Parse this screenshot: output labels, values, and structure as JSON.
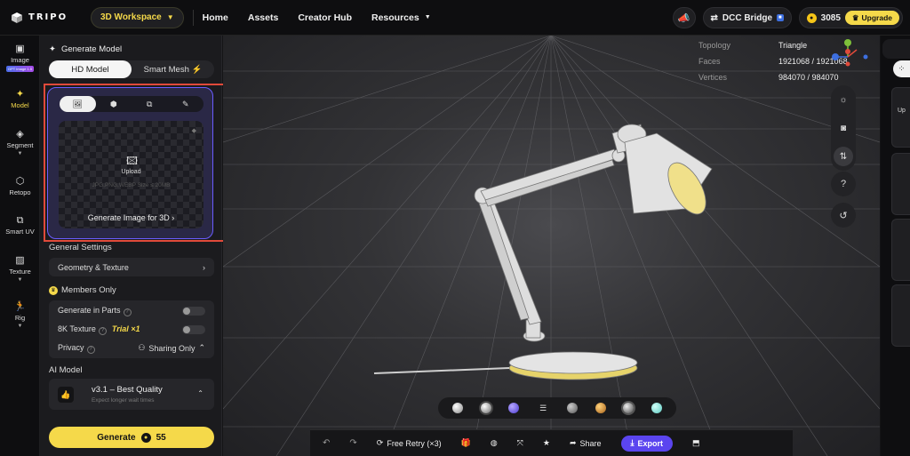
{
  "topbar": {
    "logo_text": "TRIPO",
    "workspace_label": "3D Workspace",
    "nav": [
      {
        "label": "Home"
      },
      {
        "label": "Assets"
      },
      {
        "label": "Creator Hub"
      },
      {
        "label": "Resources"
      }
    ],
    "dcc_bridge_label": "DCC Bridge",
    "credits": "3085",
    "upgrade_label": "Upgrade"
  },
  "rail": {
    "items": [
      {
        "label": "Image",
        "badge": "GPT Image 1.5",
        "icon": "image-icon"
      },
      {
        "label": "Model",
        "icon": "sparkle-icon",
        "active": true
      },
      {
        "label": "Segment",
        "icon": "cube-split-icon"
      },
      {
        "label": "Retopo",
        "icon": "mesh-icon"
      },
      {
        "label": "Smart UV",
        "icon": "uv-icon"
      },
      {
        "label": "Texture",
        "icon": "texture-icon"
      },
      {
        "label": "Rig",
        "icon": "rig-icon"
      }
    ]
  },
  "panel": {
    "title": "Generate Model",
    "mode_options": [
      {
        "label": "HD Model",
        "active": true
      },
      {
        "label": "Smart Mesh ⚡",
        "active": false
      }
    ],
    "upload": {
      "tabs": [
        "image-icon",
        "cube-icon",
        "images-icon",
        "pencil-icon"
      ],
      "label": "Upload",
      "formats": "JPG,PNG,WEBP Size ≤ 20MB",
      "generate_image_link": "Generate Image for 3D"
    },
    "general_settings_label": "General Settings",
    "geometry_texture_label": "Geometry & Texture",
    "members_only_label": "Members Only",
    "options": {
      "generate_in_parts": "Generate in Parts",
      "texture_8k": "8K Texture",
      "trial_label": "Trial ×1",
      "privacy": "Privacy",
      "privacy_value": "Sharing Only"
    },
    "ai_model_label": "AI Model",
    "ai_model": {
      "title": "v3.1 – Best Quality",
      "subtitle": "Expect longer wait times"
    },
    "generate_label": "Generate",
    "generate_cost": "55"
  },
  "viewport": {
    "stats": [
      {
        "label": "Topology",
        "value": "Triangle"
      },
      {
        "label": "Faces",
        "value": "1921068 / 1921068"
      },
      {
        "label": "Vertices",
        "value": "984070 / 984070"
      }
    ],
    "bottom_bar": {
      "free_retry": "Free Retry (×3)",
      "share": "Share",
      "export": "Export"
    },
    "materials": [
      "#d8d8d8",
      "#e8e8e8",
      "#7a6cf0",
      "#9a9a9a",
      "#e0a040",
      "#c8c8c8",
      "#8fe8e0"
    ]
  },
  "right_panel": {
    "card_text": "Up"
  },
  "colors": {
    "accent_yellow": "#f5d94a",
    "export_purple": "#5b45ef",
    "upload_border": "#6a5cff",
    "highlight_red": "#e04a3a"
  }
}
